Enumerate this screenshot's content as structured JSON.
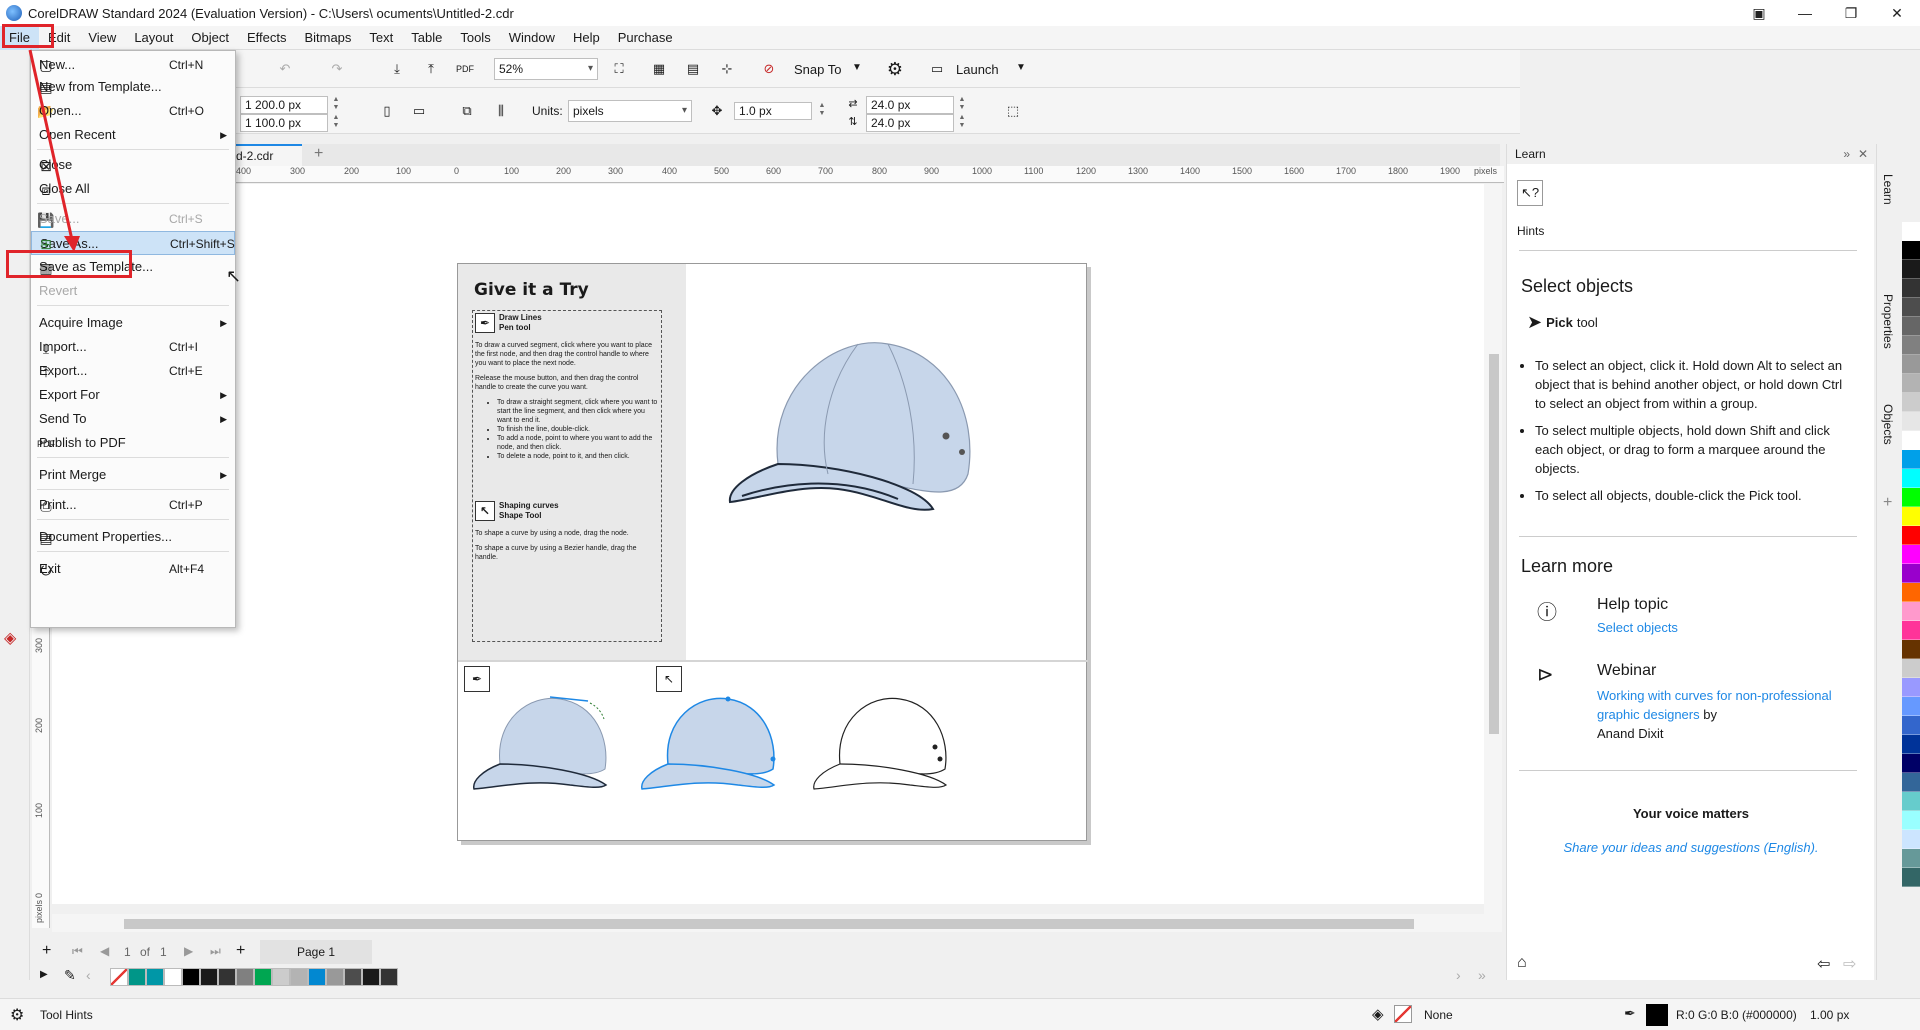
{
  "window": {
    "title": "CorelDRAW Standard 2024 (Evaluation Version) - C:\\Users\\       ocuments\\Untitled-2.cdr"
  },
  "menubar": [
    "File",
    "Edit",
    "View",
    "Layout",
    "Object",
    "Effects",
    "Bitmaps",
    "Text",
    "Table",
    "Tools",
    "Window",
    "Help",
    "Purchase"
  ],
  "toolbar": {
    "zoom": "52%",
    "snap_to": "Snap To",
    "launch": "Launch",
    "width": "1 200.0 px",
    "height": "1 100.0 px",
    "units_label": "Units:",
    "units_value": "pixels",
    "nudge": "1.0 px",
    "dup_x": "24.0 px",
    "dup_y": "24.0 px"
  },
  "document": {
    "tab_label": "d-2.cdr",
    "ruler_h": [
      "400",
      "300",
      "200",
      "100",
      "0",
      "100",
      "200",
      "300",
      "400",
      "500",
      "600",
      "700",
      "800",
      "900",
      "1000",
      "1100",
      "1200",
      "1300",
      "1400",
      "1500",
      "1600",
      "1700",
      "1800",
      "1900",
      "pixels"
    ],
    "ruler_v": [
      "300",
      "200",
      "100",
      "0",
      "pixels"
    ]
  },
  "page_content": {
    "title": "Give it a Try",
    "draw_lines_title": "Draw Lines",
    "draw_lines_sub": "Pen tool",
    "p1": "To draw a curved segment, click where you want to place the first node, and then drag the control handle to where you want to place the next node.",
    "p2": "Release the mouse button, and then drag the control handle to create the curve you want.",
    "bullets": [
      "To draw a straight segment, click where you want to start the line segment, and then click where you want to end it.",
      "To finish the line, double-click.",
      "To add a node, point to where you want to add the node, and then click.",
      "To delete a node, point to it, and then click."
    ],
    "shaping_title": "Shaping curves",
    "shaping_sub": "Shape Tool",
    "p3": "To shape a curve by using a node, drag the node.",
    "p4": "To shape a curve by using a Bezier handle, drag the handle."
  },
  "file_menu": {
    "items": [
      {
        "label": "New...",
        "shortcut": "Ctrl+N"
      },
      {
        "label": "New from Template...",
        "shortcut": ""
      },
      {
        "label": "Open...",
        "shortcut": "Ctrl+O"
      },
      {
        "label": "Open Recent",
        "shortcut": ""
      },
      {
        "label": "Close",
        "shortcut": ""
      },
      {
        "label": "Close All",
        "shortcut": ""
      },
      {
        "label": "Save...",
        "shortcut": "Ctrl+S"
      },
      {
        "label": "Save As...",
        "shortcut": "Ctrl+Shift+S"
      },
      {
        "label": "Save as Template...",
        "shortcut": ""
      },
      {
        "label": "Revert",
        "shortcut": ""
      },
      {
        "label": "Acquire Image",
        "shortcut": ""
      },
      {
        "label": "Import...",
        "shortcut": "Ctrl+I"
      },
      {
        "label": "Export...",
        "shortcut": "Ctrl+E"
      },
      {
        "label": "Export For",
        "shortcut": ""
      },
      {
        "label": "Send To",
        "shortcut": ""
      },
      {
        "label": "Publish to PDF",
        "shortcut": ""
      },
      {
        "label": "Print Merge",
        "shortcut": ""
      },
      {
        "label": "Print...",
        "shortcut": "Ctrl+P"
      },
      {
        "label": "Document Properties...",
        "shortcut": ""
      },
      {
        "label": "Exit",
        "shortcut": "Alt+F4"
      }
    ]
  },
  "page_nav": {
    "counter": "1",
    "of": "of",
    "total": "1",
    "page_tab": "Page 1"
  },
  "learn_panel": {
    "header": "Learn",
    "hints": "Hints",
    "select_objects": "Select objects",
    "pick_tool": "Pick",
    "pick_tool_suffix": " tool",
    "bullets": [
      "To select an object, click it. Hold down Alt to select an object that is behind another object, or hold down Ctrl to select an object from within a group.",
      "To select multiple objects, hold down Shift and click each object, or drag to form a marquee around the objects.",
      "To select all objects, double-click the Pick tool."
    ],
    "learn_more": "Learn more",
    "help_topic": "Help topic",
    "help_link": "Select objects",
    "webinar": "Webinar",
    "webinar_link": "Working with curves for non-professional graphic designers",
    "webinar_by": " by",
    "webinar_author": "Anand Dixit",
    "voice": "Your voice matters",
    "voice_link": "Share your ideas and suggestions (English)."
  },
  "docker_tabs": [
    "Learn",
    "Properties",
    "Objects"
  ],
  "status": {
    "tool_hints": "Tool Hints",
    "fill": "None",
    "outline_color": "R:0 G:0 B:0 (#000000)",
    "outline_width": "1.00 px"
  },
  "colors": {
    "accent": "#1e88e5",
    "annotation_red": "#e0242a",
    "palette_right": [
      "#ffffff",
      "#000000",
      "#1a1a1a",
      "#333333",
      "#4d4d4d",
      "#666666",
      "#808080",
      "#999999",
      "#b3b3b3",
      "#cccccc",
      "#e6e6e6",
      "#ffffff",
      "#00a0e9",
      "#00ffff",
      "#00ff00",
      "#ffff00",
      "#ff0000",
      "#ff00ff",
      "#9900cc",
      "#ff6600",
      "#ff99cc",
      "#ff3399",
      "#663300",
      "#cccccc",
      "#9999ff",
      "#6699ff",
      "#3366cc",
      "#003399",
      "#000066",
      "#336699",
      "#66cccc",
      "#99ffff",
      "#cce5ff",
      "#669999",
      "#336666"
    ],
    "palette_bottom": [
      "#ffffff",
      "#009688",
      "#0097a7",
      "#ffffff",
      "#000000",
      "#1a1a1a",
      "#333333",
      "#808080",
      "#00a651",
      "#cccccc",
      "#b3b3b3",
      "#0288d1",
      "#999999",
      "#4d4d4d",
      "#1a1a1a",
      "#333333"
    ]
  }
}
